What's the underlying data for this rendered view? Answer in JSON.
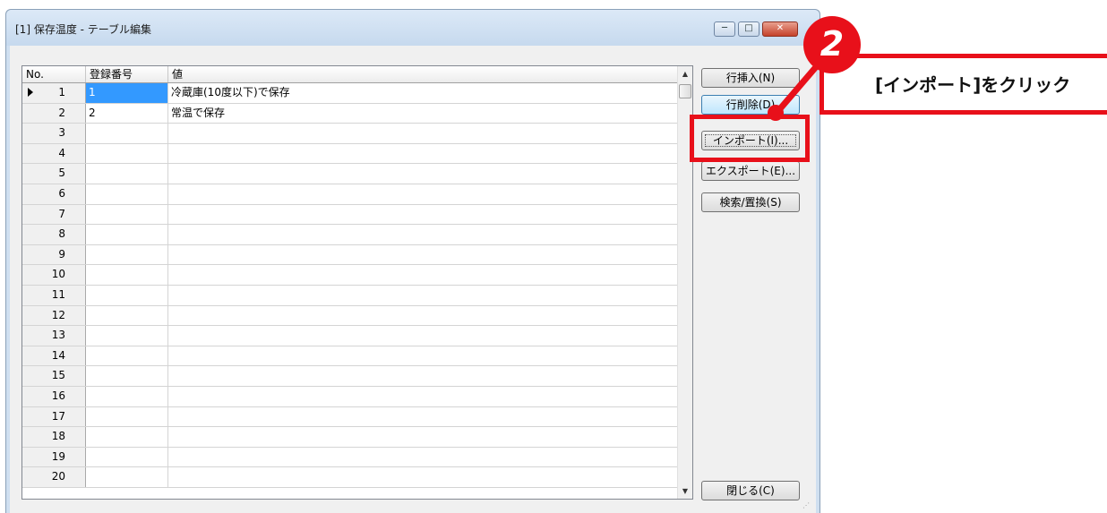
{
  "window": {
    "title": "[1] 保存温度 - テーブル編集",
    "controls": {
      "minimize": "─",
      "maximize": "□",
      "close": "✕"
    }
  },
  "table": {
    "columns": [
      "No.",
      "登録番号",
      "値"
    ],
    "rows": [
      {
        "no": "1",
        "reg": "1",
        "value": "冷蔵庫(10度以下)で保存"
      },
      {
        "no": "2",
        "reg": "2",
        "value": "常温で保存"
      },
      {
        "no": "3",
        "reg": "",
        "value": ""
      },
      {
        "no": "4",
        "reg": "",
        "value": ""
      },
      {
        "no": "5",
        "reg": "",
        "value": ""
      },
      {
        "no": "6",
        "reg": "",
        "value": ""
      },
      {
        "no": "7",
        "reg": "",
        "value": ""
      },
      {
        "no": "8",
        "reg": "",
        "value": ""
      },
      {
        "no": "9",
        "reg": "",
        "value": ""
      },
      {
        "no": "10",
        "reg": "",
        "value": ""
      },
      {
        "no": "11",
        "reg": "",
        "value": ""
      },
      {
        "no": "12",
        "reg": "",
        "value": ""
      },
      {
        "no": "13",
        "reg": "",
        "value": ""
      },
      {
        "no": "14",
        "reg": "",
        "value": ""
      },
      {
        "no": "15",
        "reg": "",
        "value": ""
      },
      {
        "no": "16",
        "reg": "",
        "value": ""
      },
      {
        "no": "17",
        "reg": "",
        "value": ""
      },
      {
        "no": "18",
        "reg": "",
        "value": ""
      },
      {
        "no": "19",
        "reg": "",
        "value": ""
      },
      {
        "no": "20",
        "reg": "",
        "value": ""
      }
    ]
  },
  "buttons": {
    "insert_row": "行挿入(N)",
    "delete_row": "行削除(D)",
    "import": "インポート(I)...",
    "export": "エクスポート(E)...",
    "search_replace": "検索/置換(S)",
    "close": "閉じる(C)"
  },
  "annotation": {
    "step": "2",
    "callout": "[インポート]をクリック",
    "color": "#e8101a"
  }
}
